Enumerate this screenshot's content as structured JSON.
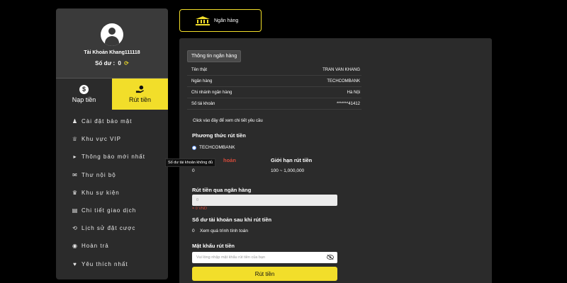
{
  "profile": {
    "account_name": "Tài Khoản Khang111118",
    "balance_label": "Số dư :",
    "balance_value": "0"
  },
  "actions": {
    "deposit_label": "Nạp tiền",
    "withdraw_label": "Rút tiền"
  },
  "menu": {
    "items": [
      {
        "label": "Cài đặt bảo mật",
        "icon": "user-lock-icon"
      },
      {
        "label": "Khu vực VIP",
        "icon": "crown-icon"
      },
      {
        "label": "Thông báo mới nhất",
        "icon": "megaphone-icon"
      },
      {
        "label": "Thư nội bộ",
        "icon": "envelope-icon"
      },
      {
        "label": "Khu sự kiện",
        "icon": "trophy-icon"
      },
      {
        "label": "Chi tiết giao dịch",
        "icon": "clipboard-icon"
      },
      {
        "label": "Lịch sử đặt cược",
        "icon": "history-icon"
      },
      {
        "label": "Hoàn trả",
        "icon": "dollar-circle-icon"
      },
      {
        "label": "Yêu thích nhất",
        "icon": "heart-icon"
      }
    ]
  },
  "tooltip": "Số dư tài khoản không đủ",
  "bank_tab": {
    "label": "Ngân hàng",
    "icon": "bank-icon"
  },
  "bank_info": {
    "title": "Thông tin ngân hàng",
    "rows": [
      {
        "label": "Tên thật",
        "value": "TRAN VAN KHANG"
      },
      {
        "label": "Ngân hàng",
        "value": "TECHCOMBANK"
      },
      {
        "label": "Chi nhánh ngân hàng",
        "value": "Hà Nội"
      },
      {
        "label": "Số tài khoản",
        "value": "*******41412"
      }
    ],
    "click_note": "Click vào đây để xem chi tiết yêu cầu"
  },
  "withdraw": {
    "method_label": "Phương thức rút tiền",
    "method_option": "TECHCOMBANK",
    "hidden_label_fragment": "hoản",
    "balance_value": "0",
    "limit_label": "Giới hạn rút tiền",
    "limit_value": "100 ~ 1,000,000",
    "amount_label": "Rút tiền qua ngân hàng",
    "amount_placeholder": "0",
    "amount_converted": "= 0 VND",
    "after_label": "Số dư tài khoản sau khi rút tiền",
    "after_value": "0",
    "formula_link": "Xem quá trình tính toán",
    "password_label": "Mật khẩu rút tiền",
    "password_placeholder": "Vui lòng nhập mật khẩu rút tiền của bạn",
    "submit_label": "Rút tiền"
  },
  "colors": {
    "accent": "#f2de2a",
    "panel": "#2b2b2b",
    "warning": "#d64a3a"
  }
}
